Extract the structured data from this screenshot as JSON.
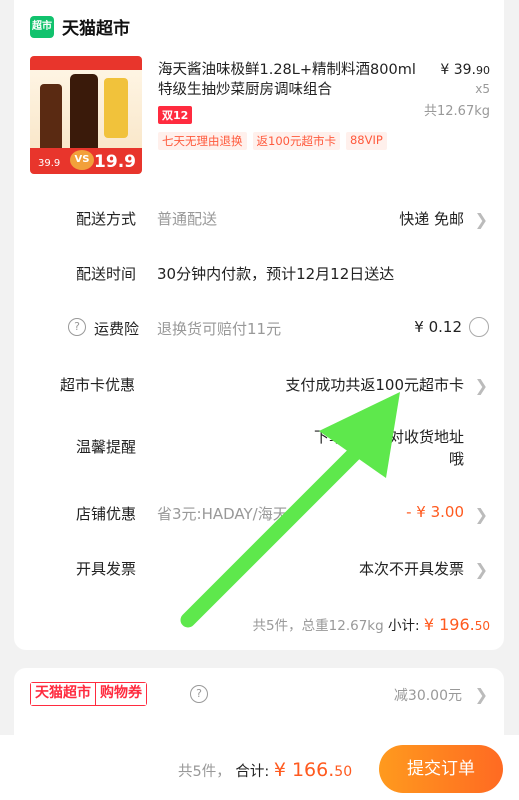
{
  "store": {
    "logo_text": "超市",
    "name": "天猫超市"
  },
  "product": {
    "title": "海天酱油味极鲜1.28L+精制料酒800ml特级生抽炒菜厨房调味组合",
    "badge": "双12",
    "tags": [
      "七天无理由退换",
      "返100元超市卡",
      "88VIP"
    ],
    "price_main": "¥ 39.",
    "price_small": "90",
    "quantity": "x5",
    "weight": "共12.67kg",
    "thumb": {
      "promo_price_left": "39.9",
      "vs": "VS",
      "promo_price_right": "19.9"
    }
  },
  "rows": {
    "delivery_method": {
      "label": "配送方式",
      "sub": "普通配送",
      "value": "快递 免邮"
    },
    "delivery_time": {
      "label": "配送时间",
      "value": "30分钟内付款，预计12月12日送达"
    },
    "shipping_insurance": {
      "label": "运费险",
      "sub": "退换货可赔付11元",
      "value": "¥ 0.12"
    },
    "card_discount": {
      "label": "超市卡优惠",
      "value": "支付成功共返100元超市卡"
    },
    "reminder": {
      "label": "温馨提醒",
      "value_line1": "下单前请核对收货地址",
      "value_line2": "哦"
    },
    "store_discount": {
      "label": "店铺优惠",
      "sub": "省3元:HADAY/海天",
      "value": "- ¥ 3.00"
    },
    "invoice": {
      "label": "开具发票",
      "value": "本次不开具发票"
    }
  },
  "subtotal": {
    "meta": "共5件，总重12.67kg",
    "label": "小计:",
    "amount_main": "¥ 196.",
    "amount_small": "50"
  },
  "coupon": {
    "brand": "天猫超市",
    "type": "购物券",
    "value": "减30.00元"
  },
  "bottom": {
    "meta": "共5件，",
    "label": "合计:",
    "amount_main": "¥ 166.",
    "amount_small": "50",
    "submit": "提交订单"
  },
  "colors": {
    "accent": "#ff5a1f",
    "brand_green": "#11c26d",
    "tag_red": "#ff2b3f",
    "arrow": "#5ee84c"
  },
  "icons": {
    "help": "question-circle-icon",
    "chevron": "chevron-right-icon",
    "radio": "radio-empty-icon"
  }
}
